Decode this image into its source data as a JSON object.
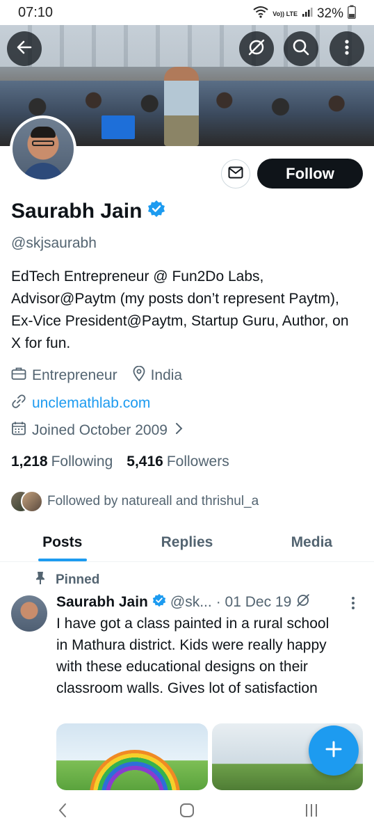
{
  "status_bar": {
    "time": "07:10",
    "network_label": "Vo)) LTE",
    "battery": "32%"
  },
  "profile": {
    "name": "Saurabh Jain",
    "handle": "@skjsaurabh",
    "bio": "EdTech Entrepreneur @ Fun2Do Labs, Advisor@Paytm (my posts don’t represent Paytm), Ex-Vice President@Paytm, Startup Guru, Author, on X for fun.",
    "category": "Entrepreneur",
    "location": "India",
    "website": "unclemathlab.com",
    "joined": "Joined October 2009",
    "following_count": "1,218",
    "following_label": "Following",
    "followers_count": "5,416",
    "followers_label": "Followers",
    "followed_by": "Followed by natureall and thrishul_a",
    "verified": true
  },
  "actions": {
    "follow_label": "Follow",
    "back_icon": "arrow-left-icon",
    "grok_icon": "slash-circle-icon",
    "search_icon": "search-icon",
    "more_icon": "more-vertical-icon",
    "message_icon": "mail-icon"
  },
  "tabs": [
    {
      "label": "Posts",
      "active": true
    },
    {
      "label": "Replies",
      "active": false
    },
    {
      "label": "Media",
      "active": false
    }
  ],
  "post": {
    "pinned_label": "Pinned",
    "author_name": "Saurabh Jain",
    "author_handle": "@sk...",
    "date": "· 01 Dec 19",
    "text": "I have got a class painted in a rural school in Mathura district. Kids were really happy with these educational designs on their classroom walls. Gives lot of satisfaction"
  },
  "colors": {
    "accent": "#1d9bf0",
    "text_primary": "#0f1419",
    "text_secondary": "#536471",
    "follow_bg": "#0f1419"
  }
}
